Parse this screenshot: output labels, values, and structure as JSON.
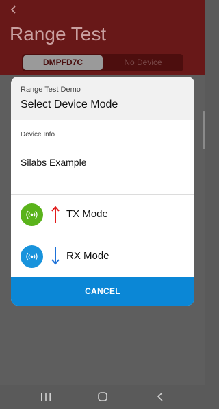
{
  "app": {
    "title": "Range Test",
    "back_glyph": "‹",
    "segments": {
      "active": "DMPFD7C",
      "inactive": "No Device"
    }
  },
  "dialog": {
    "subtitle": "Range Test Demo",
    "title": "Select Device Mode",
    "info_label": "Device Info",
    "info_value": "Silabs Example",
    "modes": [
      {
        "label": "TX Mode",
        "icon": "antenna-icon",
        "arrow": "arrow-up-icon",
        "icon_color": "#5ab31b",
        "arrow_color": "#e21c1c"
      },
      {
        "label": "RX Mode",
        "icon": "antenna-icon",
        "arrow": "arrow-down-icon",
        "icon_color": "#1893dc",
        "arrow_color": "#1e72d8"
      }
    ],
    "cancel_label": "CANCEL"
  },
  "colors": {
    "header": "#681818",
    "overlay": "#5a5a5a",
    "primary_button": "#0b87d6"
  },
  "navbar": {
    "recent_icon": "recent-apps-icon",
    "home_icon": "home-icon",
    "back_icon": "back-icon"
  }
}
